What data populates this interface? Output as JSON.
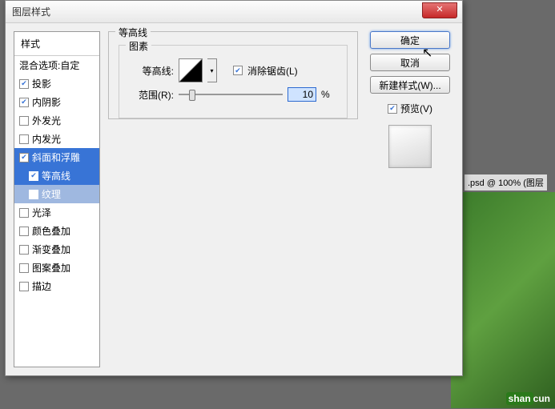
{
  "bg": {
    "doc_title": ".psd @ 100% (图层"
  },
  "watermark": {
    "text_a": "shan",
    "text_b": "cun"
  },
  "dialog": {
    "title": "图层样式",
    "close": "✕",
    "left": {
      "header": "样式",
      "items": [
        {
          "label": "混合选项:自定",
          "checked": null
        },
        {
          "label": "投影",
          "checked": true
        },
        {
          "label": "内阴影",
          "checked": true
        },
        {
          "label": "外发光",
          "checked": false
        },
        {
          "label": "内发光",
          "checked": false
        },
        {
          "label": "斜面和浮雕",
          "checked": true,
          "selected": false,
          "hl": true
        },
        {
          "label": "等高线",
          "checked": true,
          "sub": true,
          "selected": true
        },
        {
          "label": "纹理",
          "checked": false,
          "sub": true,
          "selected": true,
          "dim": true
        },
        {
          "label": "光泽",
          "checked": false
        },
        {
          "label": "颜色叠加",
          "checked": false
        },
        {
          "label": "渐变叠加",
          "checked": false
        },
        {
          "label": "图案叠加",
          "checked": false
        },
        {
          "label": "描边",
          "checked": false
        }
      ]
    },
    "mid": {
      "group_title": "等高线",
      "elements_title": "图素",
      "contour_label": "等高线:",
      "antialias_label": "消除锯齿(L)",
      "antialias_checked": true,
      "range_label": "范围(R):",
      "range_value": "10",
      "range_unit": "%"
    },
    "right": {
      "ok": "确定",
      "cancel": "取消",
      "new_style": "新建样式(W)...",
      "preview_label": "预览(V)",
      "preview_checked": true
    }
  }
}
